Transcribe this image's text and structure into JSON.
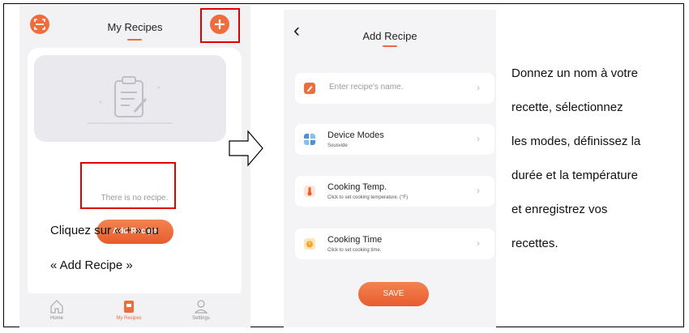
{
  "my_recipes": {
    "title": "My Recipes",
    "empty_text": "There is no recipe.",
    "add_button": "Add Recipe",
    "nav": [
      {
        "label": "Home",
        "icon": "house-icon"
      },
      {
        "label": "My Recipes",
        "icon": "recipe-book-icon"
      },
      {
        "label": "Settings",
        "icon": "user-settings-icon"
      }
    ]
  },
  "instruction_left": {
    "line1": "Cliquez sur « + » ou",
    "line2": "« Add Recipe »"
  },
  "add_recipe": {
    "back": "‹",
    "title": "Add Recipe",
    "name_placeholder": "Enter recipe's name.",
    "device_modes": {
      "label": "Device Modes",
      "value": "Sousvide"
    },
    "cooking_temp": {
      "label": "Cooking Temp.",
      "hint": "Click to set cooking temperature. (°F)"
    },
    "cooking_time": {
      "label": "Cooking Time",
      "hint": "Click to set cooking time."
    },
    "save": "SAVE"
  },
  "description": [
    "Donnez un nom à votre",
    "recette, sélectionnez",
    "les modes, définissez la",
    "durée et la température",
    "et enregistrez vos",
    "recettes."
  ],
  "colors": {
    "accent": "#ef6d3c",
    "highlight": "#e00000"
  }
}
